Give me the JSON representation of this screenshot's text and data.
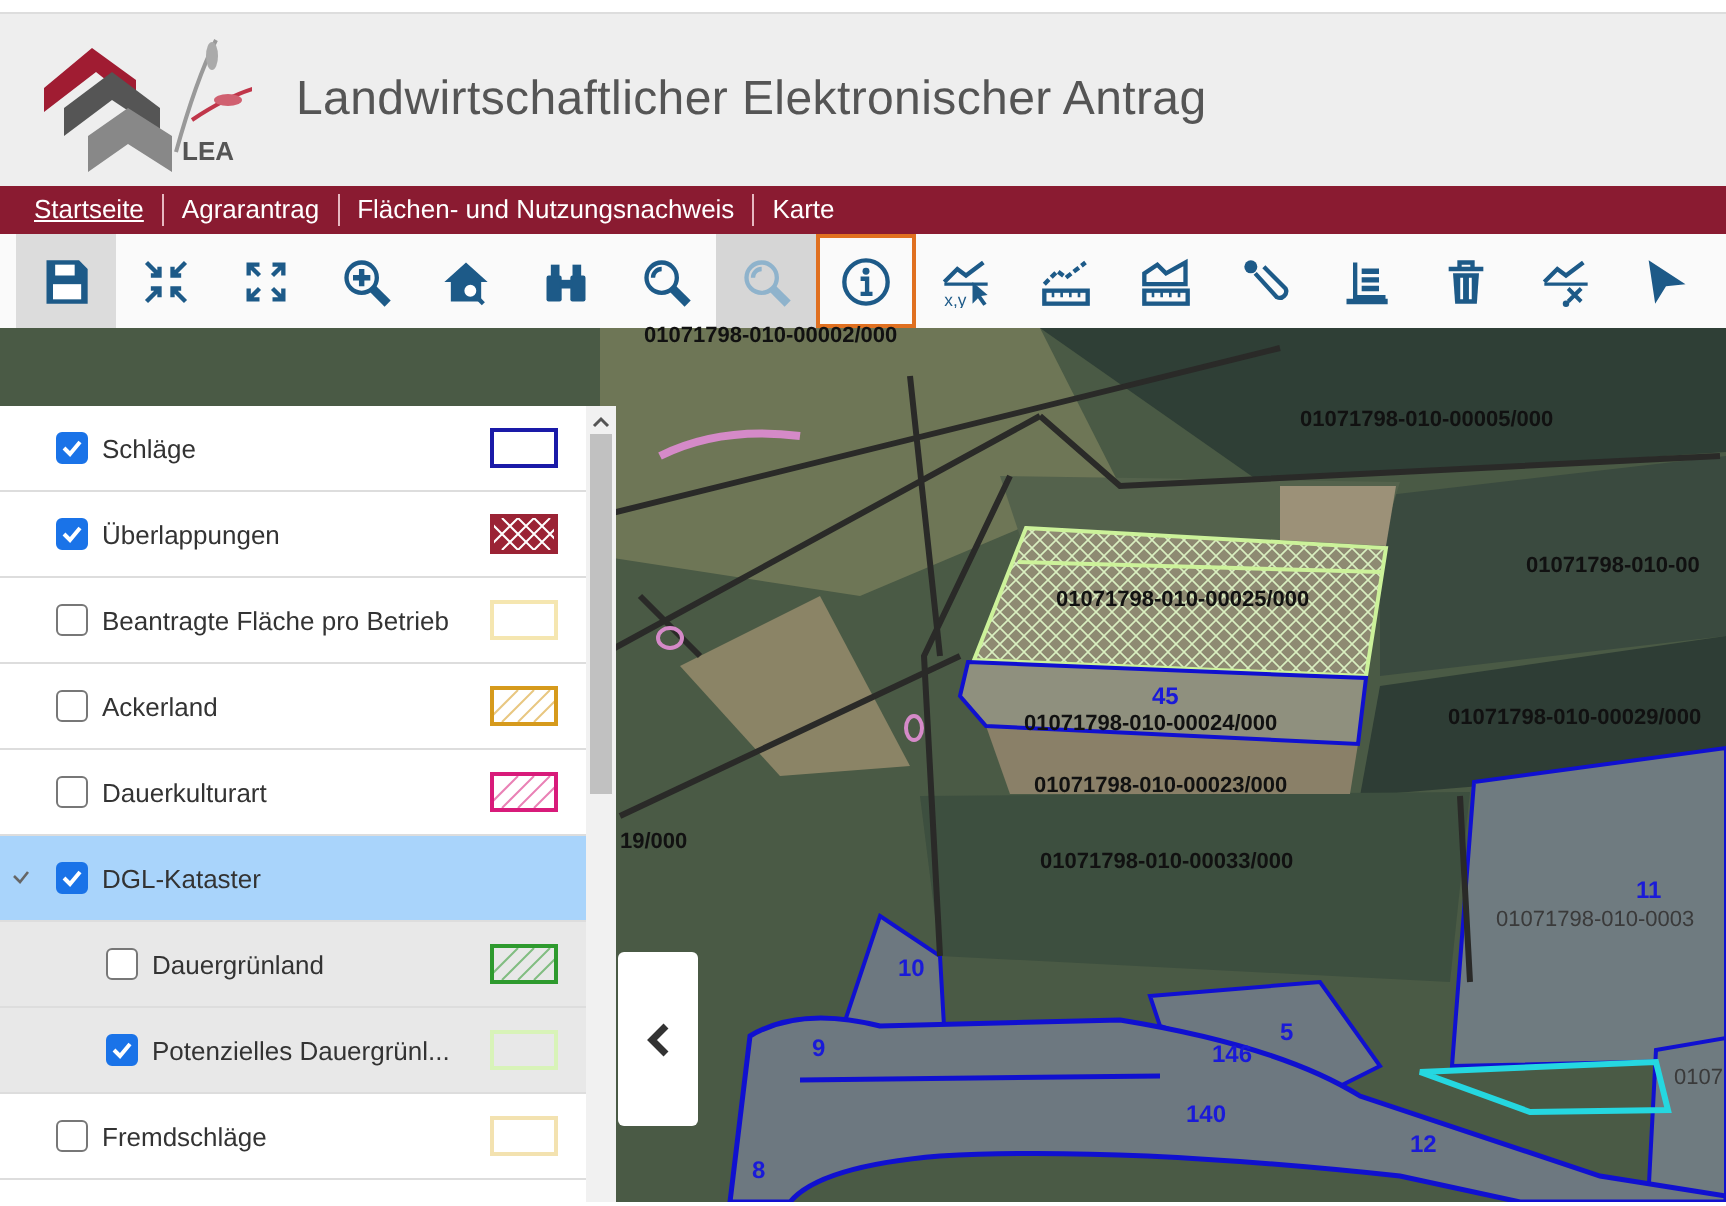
{
  "header": {
    "logo_text": "LEA",
    "title": "Landwirtschaftlicher Elektronischer Antrag"
  },
  "nav": [
    {
      "label": "Startseite",
      "selected": true
    },
    {
      "label": "Agrarantrag",
      "selected": false
    },
    {
      "label": "Flächen- und Nutzungsnachweis",
      "selected": false
    },
    {
      "label": "Karte",
      "selected": false
    }
  ],
  "toolbar": [
    {
      "kind": "save",
      "pressed": true,
      "disabled": false,
      "selected": false
    },
    {
      "kind": "collapse",
      "pressed": false,
      "disabled": false,
      "selected": false
    },
    {
      "kind": "expand",
      "pressed": false,
      "disabled": false,
      "selected": false
    },
    {
      "kind": "zoom-in",
      "pressed": false,
      "disabled": false,
      "selected": false
    },
    {
      "kind": "home-zoom",
      "pressed": false,
      "disabled": false,
      "selected": false
    },
    {
      "kind": "binoculars",
      "pressed": false,
      "disabled": false,
      "selected": false
    },
    {
      "kind": "zoom",
      "pressed": false,
      "disabled": false,
      "selected": false
    },
    {
      "kind": "zoom",
      "pressed": false,
      "disabled": true,
      "selected": false
    },
    {
      "kind": "info",
      "pressed": false,
      "disabled": false,
      "selected": true
    },
    {
      "kind": "coordinates",
      "caption": "x,y",
      "pressed": false,
      "disabled": false,
      "selected": false
    },
    {
      "kind": "measure-line",
      "pressed": false,
      "disabled": false,
      "selected": false
    },
    {
      "kind": "measure-area",
      "pressed": false,
      "disabled": false,
      "selected": false
    },
    {
      "kind": "snap",
      "pressed": false,
      "disabled": false,
      "selected": false
    },
    {
      "kind": "list",
      "pressed": false,
      "disabled": false,
      "selected": false
    },
    {
      "kind": "trash",
      "pressed": false,
      "disabled": false,
      "selected": false
    },
    {
      "kind": "cut",
      "pressed": false,
      "disabled": false,
      "selected": false
    },
    {
      "kind": "pointer",
      "pressed": false,
      "disabled": false,
      "selected": false
    }
  ],
  "layers": [
    {
      "label": "Schläge",
      "checked": true,
      "selected": false,
      "swatch": {
        "kind": "outline",
        "color": "#1a1aa8"
      }
    },
    {
      "label": "Überlappungen",
      "checked": true,
      "selected": false,
      "swatch": {
        "kind": "crosshatch",
        "color": "#9b2335"
      }
    },
    {
      "label": "Beantragte Fläche pro Betrieb",
      "checked": false,
      "selected": false,
      "swatch": {
        "kind": "outline",
        "color": "#f5e6b0"
      }
    },
    {
      "label": "Ackerland",
      "checked": false,
      "selected": false,
      "swatch": {
        "kind": "hatch",
        "color": "#d69a1c"
      }
    },
    {
      "label": "Dauerkulturart",
      "checked": false,
      "selected": false,
      "swatch": {
        "kind": "hatch",
        "color": "#d81b7a"
      }
    },
    {
      "label": "DGL-Kataster",
      "checked": true,
      "selected": true,
      "expanded": true,
      "children": [
        {
          "label": "Dauergrünland",
          "checked": false,
          "selected": false,
          "swatch": {
            "kind": "hatch",
            "color": "#2e9a2e"
          }
        },
        {
          "label": "Potenzielles Dauergrünl...",
          "checked": true,
          "selected": false,
          "swatch": {
            "kind": "outline",
            "color": "#d8f3b8"
          }
        }
      ]
    },
    {
      "label": "Fremdschläge",
      "checked": false,
      "selected": false,
      "swatch": {
        "kind": "outline",
        "color": "#f3e2b0"
      }
    }
  ],
  "map_labels": [
    {
      "text": "01071798-010-00002/000",
      "kind": "parcel_id"
    },
    {
      "text": "01071798-010-00005/000",
      "kind": "parcel_id"
    },
    {
      "text": "01071798-010-00",
      "kind": "parcel_id"
    },
    {
      "text": "01071798-010-00025/000",
      "kind": "parcel_id"
    },
    {
      "text": "45",
      "kind": "field_number"
    },
    {
      "text": "01071798-010-00024/000",
      "kind": "parcel_id"
    },
    {
      "text": "01071798-010-00029/000",
      "kind": "parcel_id"
    },
    {
      "text": "01071798-010-00023/000",
      "kind": "parcel_id"
    },
    {
      "text": "19/000",
      "kind": "parcel_id"
    },
    {
      "text": "01071798-010-00033/000",
      "kind": "parcel_id"
    },
    {
      "text": "11",
      "kind": "field_number"
    },
    {
      "text": "01071798-010-0003",
      "kind": "parcel_id_faint"
    },
    {
      "text": "10",
      "kind": "field_number"
    },
    {
      "text": "9",
      "kind": "field_number"
    },
    {
      "text": "5",
      "kind": "field_number"
    },
    {
      "text": "146",
      "kind": "field_number"
    },
    {
      "text": "140",
      "kind": "field_number"
    },
    {
      "text": "12",
      "kind": "field_number"
    },
    {
      "text": "8",
      "kind": "field_number"
    },
    {
      "text": "0107",
      "kind": "parcel_id_faint"
    }
  ]
}
